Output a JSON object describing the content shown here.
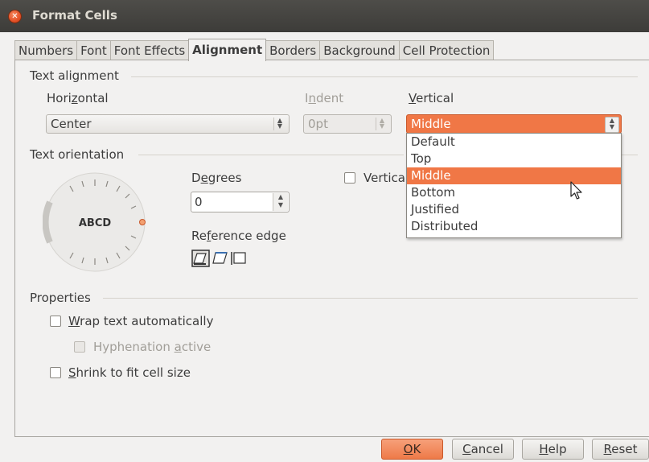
{
  "window": {
    "title": "Format Cells"
  },
  "tabs": [
    "Numbers",
    "Font",
    "Font Effects",
    "Alignment",
    "Borders",
    "Background",
    "Cell Protection"
  ],
  "active_tab": "Alignment",
  "text_alignment": {
    "section": "Text alignment",
    "horizontal_label_pre": "Hori",
    "horizontal_label_u": "z",
    "horizontal_label_post": "ontal",
    "horizontal_value": "Center",
    "indent_label_pre": "I",
    "indent_label_u": "n",
    "indent_label_post": "dent",
    "indent_value": "0pt",
    "vertical_label_u": "V",
    "vertical_label_post": "ertical",
    "vertical_value": "Middle",
    "vertical_options": [
      "Default",
      "Top",
      "Middle",
      "Bottom",
      "Justified",
      "Distributed"
    ],
    "vertical_highlighted": "Middle"
  },
  "text_orientation": {
    "section": "Text orientation",
    "dial_text": "ABCD",
    "degrees_label_pre": "D",
    "degrees_label_u": "e",
    "degrees_label_post": "grees",
    "degrees_value": "0",
    "vertically_stacked_label": "Vertica",
    "reference_edge_label_pre": "Re",
    "reference_edge_label_u": "f",
    "reference_edge_label_post": "erence edge"
  },
  "properties": {
    "section": "Properties",
    "wrap_u": "W",
    "wrap_post": "rap text automatically",
    "hyphen_pre": "Hyphenation ",
    "hyphen_u": "a",
    "hyphen_post": "ctive",
    "shrink_u": "S",
    "shrink_post": "hrink to fit cell size"
  },
  "buttons": {
    "ok_u": "O",
    "ok_post": "K",
    "cancel_u": "C",
    "cancel_post": "ancel",
    "help_u": "H",
    "help_post": "elp",
    "reset_u": "R",
    "reset_post": "eset"
  },
  "colors": {
    "accent": "#f07746",
    "titlebar": "#3d3c39",
    "dialog_bg": "#f2f1f0"
  },
  "icons": [
    "close-icon",
    "spin-arrows-icon",
    "mouse-pointer-icon",
    "reference-edge-bottom-icon",
    "reference-edge-top-icon",
    "reference-edge-inside-icon"
  ]
}
